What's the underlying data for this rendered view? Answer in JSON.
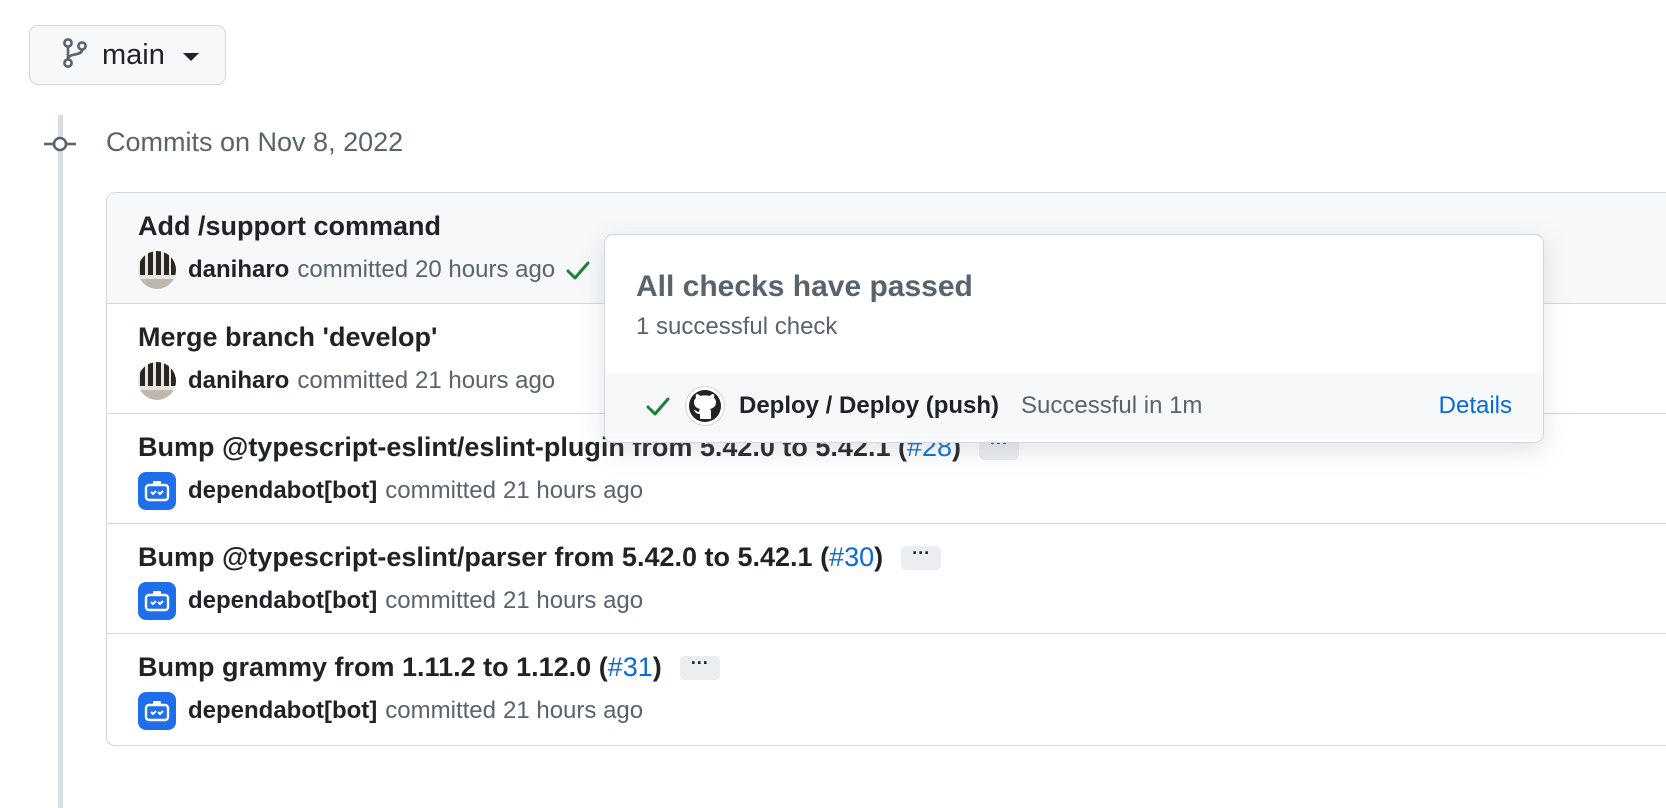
{
  "branch": {
    "name": "main",
    "icon": "git-branch-icon"
  },
  "timeline": {
    "date_heading": "Commits on Nov 8, 2022"
  },
  "commits": [
    {
      "title": "Add /support command",
      "pr_open": "",
      "pr_link": "",
      "pr_close": "",
      "author": "daniharo",
      "action": "committed",
      "time": "20 hours ago",
      "avatar": "piano-keys-avatar",
      "status": "success"
    },
    {
      "title": "Merge branch 'develop'",
      "pr_open": "",
      "pr_link": "",
      "pr_close": "",
      "author": "daniharo",
      "action": "committed",
      "time": "21 hours ago",
      "avatar": "piano-keys-avatar"
    },
    {
      "title": "Bump @typescript-eslint/eslint-plugin from 5.42.0 to 5.42.1 ",
      "pr_open": "(",
      "pr_link": "#28",
      "pr_close": ")",
      "author": "dependabot[bot]",
      "action": "committed",
      "time": "21 hours ago",
      "avatar": "dependabot-avatar"
    },
    {
      "title": "Bump @typescript-eslint/parser from 5.42.0 to 5.42.1 ",
      "pr_open": "(",
      "pr_link": "#30",
      "pr_close": ")",
      "author": "dependabot[bot]",
      "action": "committed",
      "time": "21 hours ago",
      "avatar": "dependabot-avatar"
    },
    {
      "title": "Bump grammy from 1.11.2 to 1.12.0 ",
      "pr_open": "(",
      "pr_link": "#31",
      "pr_close": ")",
      "author": "dependabot[bot]",
      "action": "committed",
      "time": "21 hours ago",
      "avatar": "dependabot-avatar"
    }
  ],
  "ellipsis_label": "···",
  "checks_popover": {
    "title": "All checks have passed",
    "subtitle": "1 successful check",
    "checks": [
      {
        "name": "Deploy / Deploy (push)",
        "status": "Successful in 1m",
        "link": "Details",
        "icon": "github-logo-icon"
      }
    ]
  },
  "colors": {
    "success": "#1a7f37",
    "link": "#0969da",
    "bot": "#1f6feb"
  }
}
